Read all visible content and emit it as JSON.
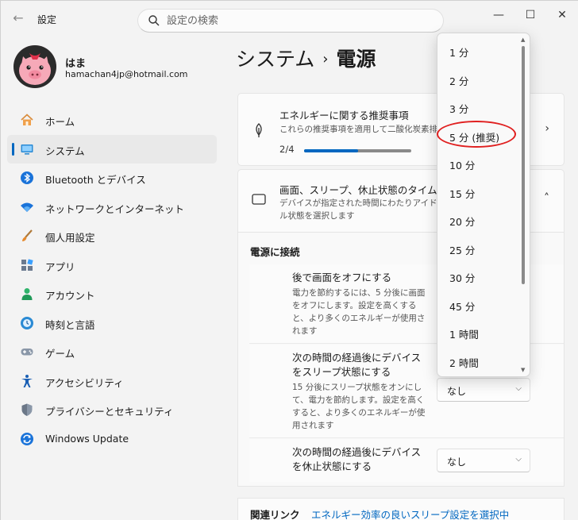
{
  "app": {
    "title": "設定"
  },
  "search": {
    "placeholder": "設定の検索"
  },
  "window_controls": {
    "minimize": "—",
    "maximize": "☐",
    "close": "✕"
  },
  "profile": {
    "name": "はま",
    "email": "hamachan4jp@hotmail.com"
  },
  "sidebar": {
    "items": [
      {
        "label": "ホーム",
        "icon": "home-icon"
      },
      {
        "label": "システム",
        "icon": "system-icon",
        "active": true
      },
      {
        "label": "Bluetooth とデバイス",
        "icon": "bluetooth-icon"
      },
      {
        "label": "ネットワークとインターネット",
        "icon": "wifi-icon"
      },
      {
        "label": "個人用設定",
        "icon": "brush-icon"
      },
      {
        "label": "アプリ",
        "icon": "apps-icon"
      },
      {
        "label": "アカウント",
        "icon": "account-icon"
      },
      {
        "label": "時刻と言語",
        "icon": "globe-clock-icon"
      },
      {
        "label": "ゲーム",
        "icon": "gamepad-icon"
      },
      {
        "label": "アクセシビリティ",
        "icon": "accessibility-icon"
      },
      {
        "label": "プライバシーとセキュリティ",
        "icon": "shield-icon"
      },
      {
        "label": "Windows Update",
        "icon": "update-icon"
      }
    ]
  },
  "breadcrumb": {
    "parent": "システム",
    "separator": "›",
    "current": "電源"
  },
  "energy_card": {
    "title": "エネルギーに関する推奨事項",
    "description": "これらの推奨事項を適用して二酸化炭素排",
    "progress_label": "2/4",
    "progress": 0.5
  },
  "timeout_card": {
    "title": "画面、スリープ、休止状態のタイムアウ",
    "description": "デバイスが指定された時間にわたりアイドル状態を選択します"
  },
  "power_section": {
    "label": "電源に接続",
    "settings": [
      {
        "title": "後で画面をオフにする",
        "description": "電力を節約するには、5 分後に画面をオフにします。設定を高くすると、より多くのエネルギーが使用されます",
        "value": ""
      },
      {
        "title": "次の時間の経過後にデバイスをスリープ状態にする",
        "description": "15 分後にスリープ状態をオンにして、電力を節約します。設定を高くすると、より多くのエネルギーが使用されます",
        "value": "なし"
      },
      {
        "title": "次の時間の経過後にデバイスを休止状態にする",
        "description": "",
        "value": "なし"
      }
    ]
  },
  "related": {
    "label": "関連リンク",
    "link": "エネルギー効率の良いスリープ設定を選択中"
  },
  "popup": {
    "options": [
      "1 分",
      "2 分",
      "3 分",
      "5 分 (推奨)",
      "10 分",
      "15 分",
      "20 分",
      "25 分",
      "30 分",
      "45 分",
      "1 時間",
      "2 時間"
    ],
    "highlighted_index": 3
  },
  "colors": {
    "accent": "#0067c0",
    "highlight": "#e02020"
  }
}
